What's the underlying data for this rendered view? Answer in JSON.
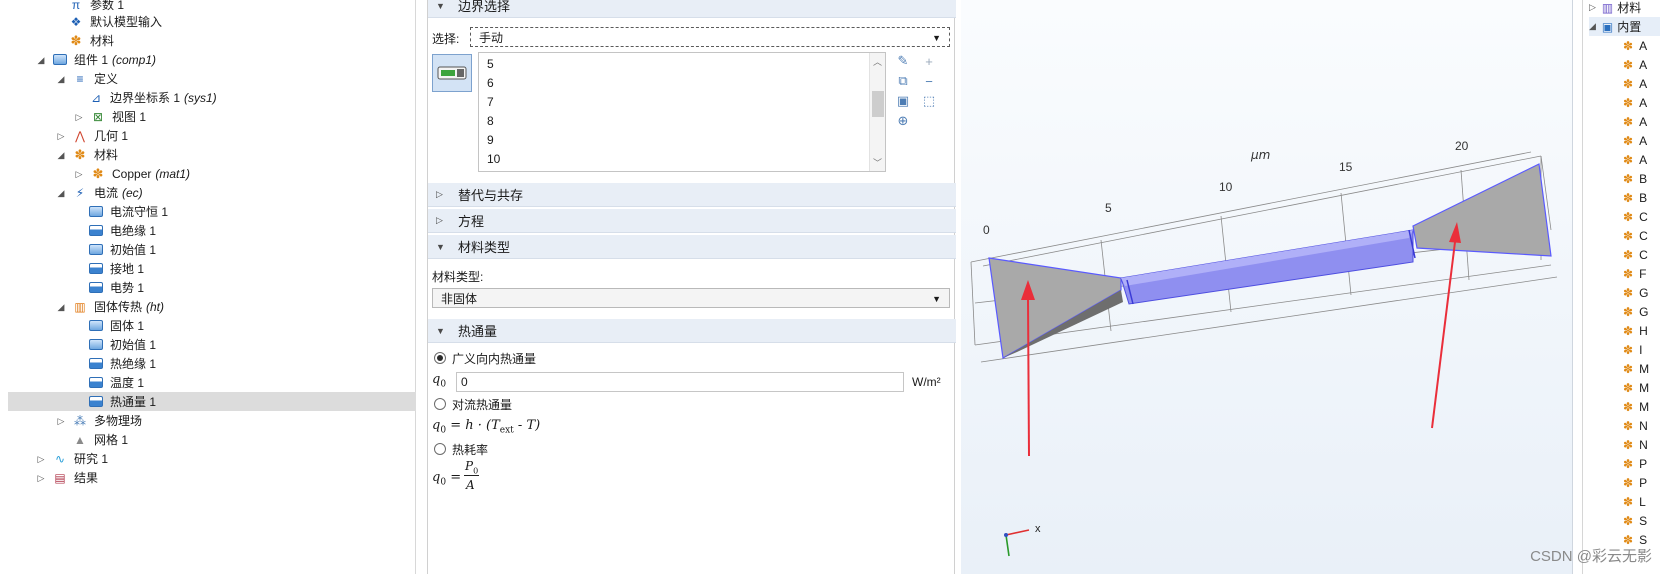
{
  "tree": {
    "items": [
      {
        "label": "参数 1",
        "tag": "",
        "icon": "parameter-icon"
      },
      {
        "label": "默认模型输入",
        "tag": "",
        "icon": "model-input-icon"
      },
      {
        "label": "材料",
        "tag": "",
        "icon": "materials-icon"
      },
      {
        "label": "组件 1",
        "tag": "(comp1)",
        "icon": "component-icon"
      },
      {
        "label": "定义",
        "tag": "",
        "icon": "definitions-icon"
      },
      {
        "label": "边界坐标系 1",
        "tag": "(sys1)",
        "icon": "boundary-system-icon"
      },
      {
        "label": "视图 1",
        "tag": "",
        "icon": "view-icon"
      },
      {
        "label": "几何 1",
        "tag": "",
        "icon": "geometry-icon"
      },
      {
        "label": "材料",
        "tag": "",
        "icon": "materials-icon"
      },
      {
        "label": "Copper",
        "tag": "(mat1)",
        "icon": "material-icon"
      },
      {
        "label": "电流",
        "tag": "(ec)",
        "icon": "electric-currents-icon"
      },
      {
        "label": "电流守恒 1",
        "tag": "",
        "icon": "domain-node-icon"
      },
      {
        "label": "电绝缘 1",
        "tag": "",
        "icon": "boundary-node-icon"
      },
      {
        "label": "初始值 1",
        "tag": "",
        "icon": "domain-node-icon"
      },
      {
        "label": "接地 1",
        "tag": "",
        "icon": "boundary-node-icon"
      },
      {
        "label": "电势 1",
        "tag": "",
        "icon": "boundary-node-icon"
      },
      {
        "label": "固体传热",
        "tag": "(ht)",
        "icon": "heat-transfer-icon"
      },
      {
        "label": "固体 1",
        "tag": "",
        "icon": "domain-node-icon"
      },
      {
        "label": "初始值 1",
        "tag": "",
        "icon": "domain-node-icon"
      },
      {
        "label": "热绝缘 1",
        "tag": "",
        "icon": "boundary-node-icon"
      },
      {
        "label": "温度 1",
        "tag": "",
        "icon": "boundary-node-icon"
      },
      {
        "label": "热通量 1",
        "tag": "",
        "icon": "boundary-node-icon"
      },
      {
        "label": "多物理场",
        "tag": "",
        "icon": "multiphysics-icon"
      },
      {
        "label": "网格 1",
        "tag": "",
        "icon": "mesh-icon"
      },
      {
        "label": "研究 1",
        "tag": "",
        "icon": "study-icon"
      },
      {
        "label": "结果",
        "tag": "",
        "icon": "results-icon"
      }
    ]
  },
  "settings": {
    "boundary_selection": {
      "title": "边界选择",
      "select_label": "选择:",
      "select_value": "手动",
      "list": [
        "5",
        "6",
        "7",
        "8",
        "9",
        "10"
      ]
    },
    "override_title": "替代与共存",
    "equation_title": "方程",
    "material_type": {
      "title": "材料类型",
      "label": "材料类型:",
      "value": "非固体"
    },
    "heat_flux": {
      "title": "热通量",
      "option1": "广义向内热通量",
      "q0_symbol": "q",
      "q0_sub": "0",
      "q0_value": "0",
      "unit": "W/m²",
      "option2": "对流热通量",
      "convective_eq": "= h · (T",
      "convective_sub": "ext",
      "convective_end": " - T)",
      "option3": "热耗率",
      "rate_eq": "=",
      "rate_num": "P",
      "rate_num_sub": "0",
      "rate_den": "A"
    }
  },
  "graphics": {
    "axis_unit": "μm",
    "ticks": [
      "0",
      "5",
      "10",
      "15",
      "20"
    ],
    "triad_x": "x",
    "colors": {
      "highlight": "#8f8ff0",
      "arrow": "#ea2e3a",
      "domain": "#a9a9a9"
    }
  },
  "rpanel": {
    "items": [
      "材料",
      "内置",
      "A",
      "A",
      "A",
      "A",
      "A",
      "A",
      "A",
      "B",
      "B",
      "C",
      "C",
      "C",
      "F",
      "G",
      "G",
      "H",
      "I",
      "M",
      "M",
      "M",
      "N",
      "N",
      "P",
      "P",
      "L",
      "S",
      "S"
    ]
  },
  "watermark": "CSDN @彩云无影"
}
